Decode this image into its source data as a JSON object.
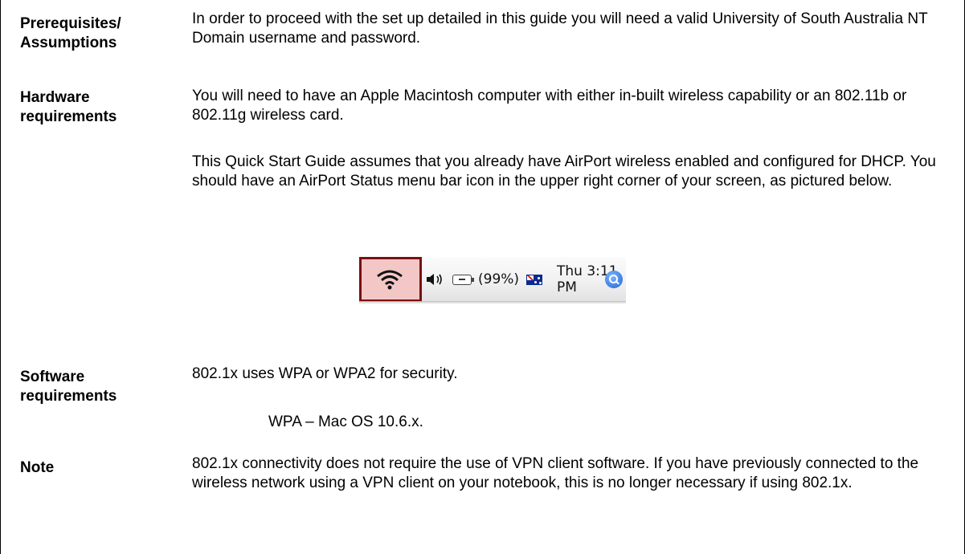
{
  "sections": {
    "prerequisites": {
      "label_line1": "Prerequisites/",
      "label_line2": "Assumptions",
      "text": "In order to proceed with the set up detailed in this guide you will need a valid University of South Australia NT Domain username and password."
    },
    "hardware": {
      "label_line1": "Hardware",
      "label_line2": "requirements",
      "text1": "You will need to have an Apple Macintosh computer with either in-built wireless capability or an 802.11b or 802.11g wireless card.",
      "text2": "This Quick Start Guide assumes that you already have AirPort wireless enabled and configured for DHCP. You should have an AirPort Status menu bar icon in the upper right corner of your screen, as pictured below."
    },
    "software": {
      "label_line1": "Software",
      "label_line2": "requirements",
      "text": "802.1x uses WPA or WPA2 for security.",
      "item": "WPA – Mac OS 10.6.x."
    },
    "note": {
      "label": "Note",
      "text": "802.1x connectivity does not require the use of VPN client software. If you have previously connected to the wireless network using  a VPN client on your notebook, this is no longer necessary if using 802.1x."
    }
  },
  "menubar": {
    "battery_text": "(99%)",
    "clock_text": "Thu 3:11 PM",
    "icons": [
      "wifi-icon",
      "volume-icon",
      "battery-icon",
      "flag-icon",
      "spotlight-icon"
    ],
    "highlight_color": "#7a1010"
  }
}
